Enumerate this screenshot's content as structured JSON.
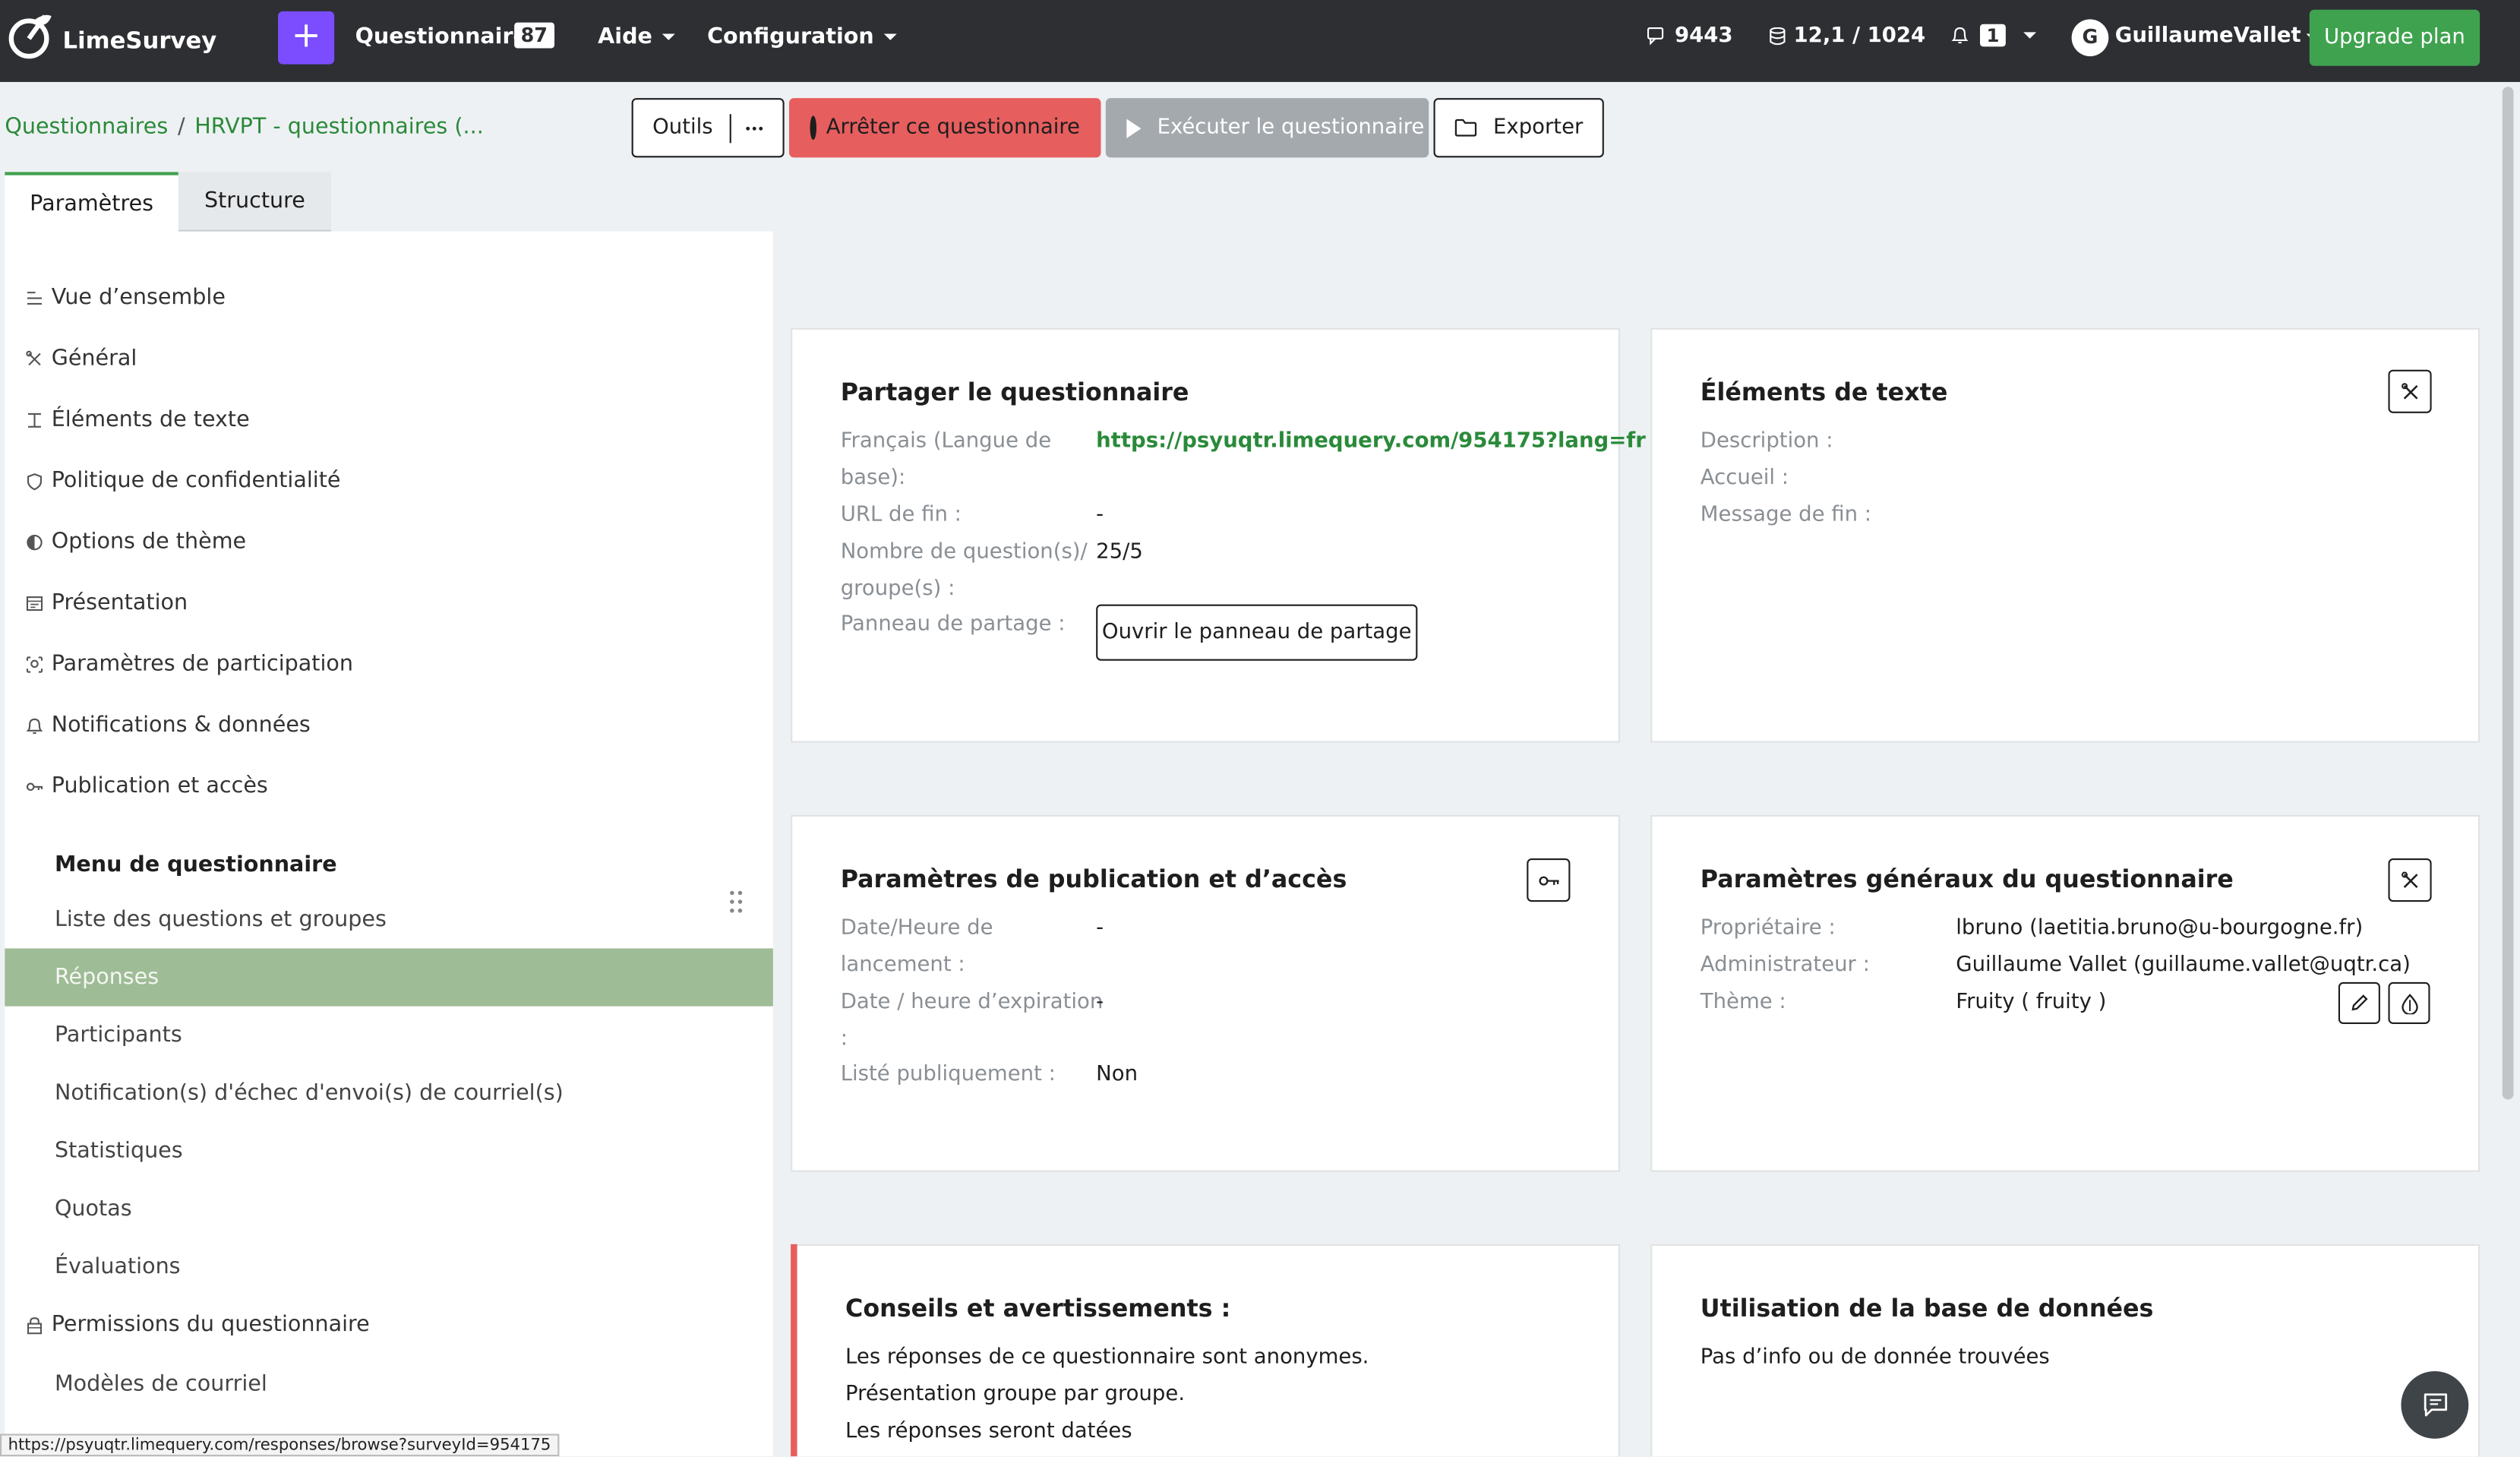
{
  "app": {
    "name": "LimeSurvey"
  },
  "navbar": {
    "questionnaires_label": "Questionnaires",
    "questionnaires_count": "87",
    "help_label": "Aide",
    "config_label": "Configuration",
    "responses_stat": "9443",
    "storage_stat": "12,1 / 1024",
    "notifications_count": "1",
    "user_initial": "G",
    "user_name": "GuillaumeVallet",
    "upgrade_label": "Upgrade plan"
  },
  "breadcrumb": {
    "root": "Questionnaires",
    "current": "HRVPT - questionnaires (..."
  },
  "toolbar": {
    "tools_label": "Outils",
    "stop_label": "Arrêter ce questionnaire",
    "run_label": "Exécuter le questionnaire",
    "export_label": "Exporter"
  },
  "tabs": [
    {
      "label": "Paramètres"
    },
    {
      "label": "Structure"
    }
  ],
  "sidebar": {
    "settings_items": [
      {
        "label": "Vue d’ensemble",
        "icon": "list-icon"
      },
      {
        "label": "Général",
        "icon": "tools-icon"
      },
      {
        "label": "Éléments de texte",
        "icon": "text-icon"
      },
      {
        "label": "Politique de confidentialité",
        "icon": "shield-icon"
      },
      {
        "label": "Options de thème",
        "icon": "contrast-icon"
      },
      {
        "label": "Présentation",
        "icon": "layout-icon"
      },
      {
        "label": "Paramètres de participation",
        "icon": "participants-icon"
      },
      {
        "label": "Notifications & données",
        "icon": "bell-icon"
      },
      {
        "label": "Publication et accès",
        "icon": "key-icon"
      }
    ],
    "menu_heading": "Menu de questionnaire",
    "menu_items": [
      {
        "label": "Liste des questions et groupes"
      },
      {
        "label": "Réponses"
      },
      {
        "label": "Participants"
      },
      {
        "label": "Notification(s) d'échec d'envoi(s) de courriel(s)"
      },
      {
        "label": "Statistiques"
      },
      {
        "label": "Quotas"
      },
      {
        "label": "Évaluations"
      },
      {
        "label": "Permissions du questionnaire"
      },
      {
        "label": "Modèles de courriel"
      }
    ],
    "active_item": "Réponses"
  },
  "cards": {
    "share": {
      "title": "Partager le questionnaire",
      "lang_label_1": "Français (Langue de",
      "lang_label_2": "base):",
      "url": "https://psyuqtr.limequery.com/954175?lang=fr",
      "end_url_label": "URL de fin :",
      "end_url_value": "-",
      "questions_label_1": "Nombre de question(s)/",
      "questions_label_2": "groupe(s) :",
      "questions_value": "25/5",
      "share_panel_label": "Panneau de partage :",
      "share_panel_button": "Ouvrir le panneau de partage"
    },
    "text_elements": {
      "title": "Éléments de texte",
      "description_label": "Description :",
      "welcome_label": "Accueil :",
      "end_message_label": "Message de fin :"
    },
    "publication": {
      "title": "Paramètres de publication et d’accès",
      "start_label_1": "Date/Heure de",
      "start_label_2": "lancement :",
      "start_value": "-",
      "expiry_label_1": "Date / heure d’expiration",
      "expiry_label_2": ":",
      "expiry_value": "-",
      "public_label": "Listé publiquement :",
      "public_value": "Non"
    },
    "general": {
      "title": "Paramètres généraux du questionnaire",
      "owner_label": "Propriétaire :",
      "owner_value": "lbruno (laetitia.bruno@u-bourgogne.fr)",
      "admin_label": "Administrateur :",
      "admin_value": "Guillaume Vallet (guillaume.vallet@uqtr.ca)",
      "theme_label": "Thème :",
      "theme_value": "Fruity ( fruity )"
    },
    "warnings": {
      "title": "Conseils et avertissements :",
      "lines": [
        "Les réponses de ce questionnaire sont anonymes.",
        "Présentation groupe par groupe.",
        "Les réponses seront datées"
      ]
    },
    "database": {
      "title": "Utilisation de la base de données",
      "message": "Pas d’info ou de donnée trouvées"
    }
  },
  "status_bar": {
    "url": "https://psyuqtr.limequery.com/responses/browse?surveyId=954175"
  },
  "colors": {
    "accent": "#3fa24f",
    "danger": "#e75e5e",
    "active_row": "#9ebc96",
    "navbar": "#2d2f33",
    "purple": "#7b4dff"
  }
}
